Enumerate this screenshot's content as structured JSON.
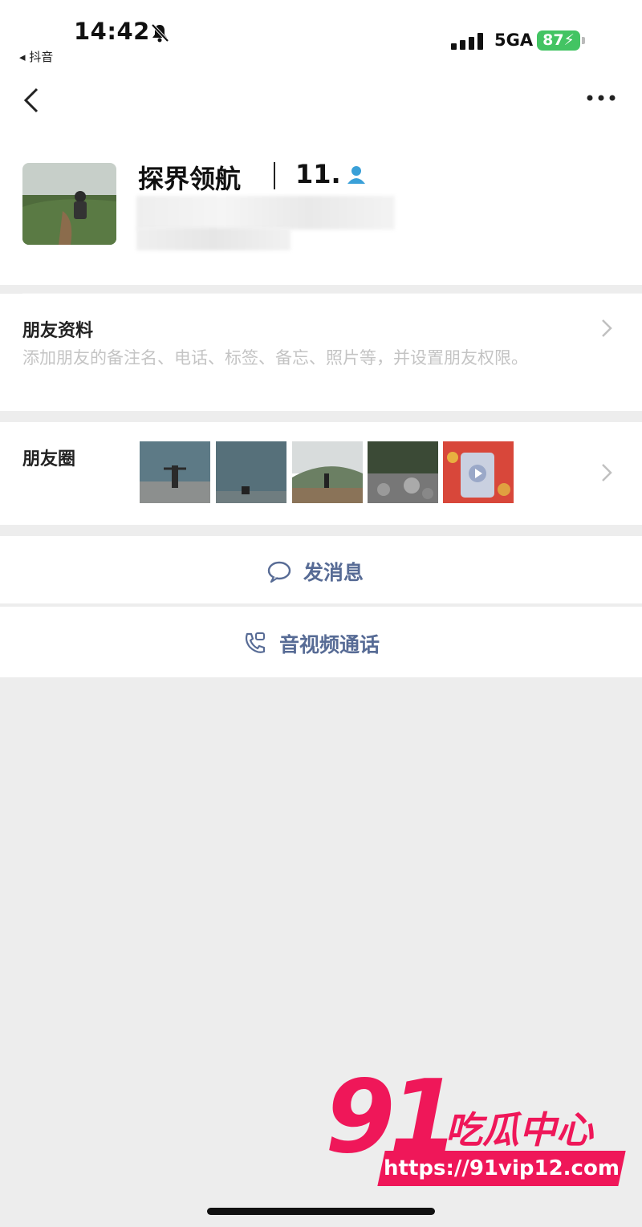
{
  "status_bar": {
    "time": "14:42",
    "back_app": "◂ 抖音",
    "network": "5GA",
    "battery": "87"
  },
  "profile": {
    "name": "探界领航",
    "name_suffix": "11."
  },
  "friend_info": {
    "title": "朋友资料",
    "description": "添加朋友的备注名、电话、标签、备忘、照片等，并设置朋友权限。"
  },
  "moments": {
    "title": "朋友圈"
  },
  "actions": {
    "message": "发消息",
    "call": "音视频通话"
  },
  "watermark": {
    "number": "91",
    "title": "吃瓜中心",
    "url": "https://91vip12.com"
  },
  "colors": {
    "link_blue": "#576b95",
    "battery_green": "#43c463",
    "watermark_pink": "#ef1759"
  }
}
